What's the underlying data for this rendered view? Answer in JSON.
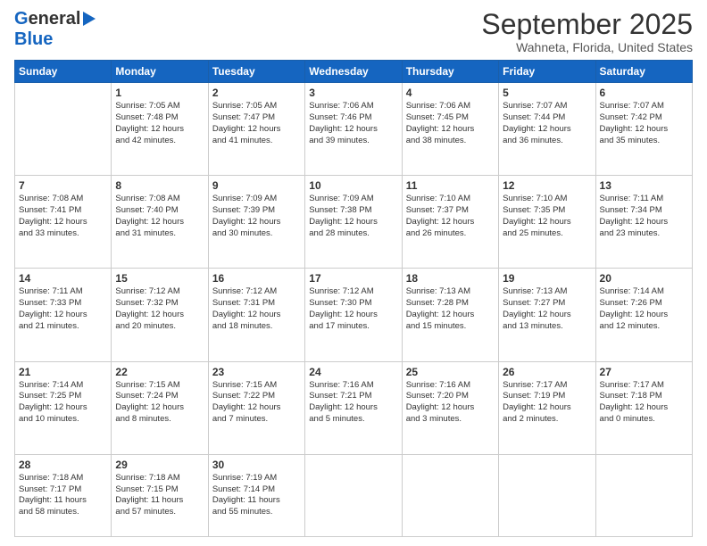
{
  "logo": {
    "line1": "General",
    "line2": "Blue",
    "arrow": true
  },
  "title": "September 2025",
  "subtitle": "Wahneta, Florida, United States",
  "weekdays": [
    "Sunday",
    "Monday",
    "Tuesday",
    "Wednesday",
    "Thursday",
    "Friday",
    "Saturday"
  ],
  "weeks": [
    [
      {
        "day": "",
        "info": ""
      },
      {
        "day": "1",
        "info": "Sunrise: 7:05 AM\nSunset: 7:48 PM\nDaylight: 12 hours\nand 42 minutes."
      },
      {
        "day": "2",
        "info": "Sunrise: 7:05 AM\nSunset: 7:47 PM\nDaylight: 12 hours\nand 41 minutes."
      },
      {
        "day": "3",
        "info": "Sunrise: 7:06 AM\nSunset: 7:46 PM\nDaylight: 12 hours\nand 39 minutes."
      },
      {
        "day": "4",
        "info": "Sunrise: 7:06 AM\nSunset: 7:45 PM\nDaylight: 12 hours\nand 38 minutes."
      },
      {
        "day": "5",
        "info": "Sunrise: 7:07 AM\nSunset: 7:44 PM\nDaylight: 12 hours\nand 36 minutes."
      },
      {
        "day": "6",
        "info": "Sunrise: 7:07 AM\nSunset: 7:42 PM\nDaylight: 12 hours\nand 35 minutes."
      }
    ],
    [
      {
        "day": "7",
        "info": "Sunrise: 7:08 AM\nSunset: 7:41 PM\nDaylight: 12 hours\nand 33 minutes."
      },
      {
        "day": "8",
        "info": "Sunrise: 7:08 AM\nSunset: 7:40 PM\nDaylight: 12 hours\nand 31 minutes."
      },
      {
        "day": "9",
        "info": "Sunrise: 7:09 AM\nSunset: 7:39 PM\nDaylight: 12 hours\nand 30 minutes."
      },
      {
        "day": "10",
        "info": "Sunrise: 7:09 AM\nSunset: 7:38 PM\nDaylight: 12 hours\nand 28 minutes."
      },
      {
        "day": "11",
        "info": "Sunrise: 7:10 AM\nSunset: 7:37 PM\nDaylight: 12 hours\nand 26 minutes."
      },
      {
        "day": "12",
        "info": "Sunrise: 7:10 AM\nSunset: 7:35 PM\nDaylight: 12 hours\nand 25 minutes."
      },
      {
        "day": "13",
        "info": "Sunrise: 7:11 AM\nSunset: 7:34 PM\nDaylight: 12 hours\nand 23 minutes."
      }
    ],
    [
      {
        "day": "14",
        "info": "Sunrise: 7:11 AM\nSunset: 7:33 PM\nDaylight: 12 hours\nand 21 minutes."
      },
      {
        "day": "15",
        "info": "Sunrise: 7:12 AM\nSunset: 7:32 PM\nDaylight: 12 hours\nand 20 minutes."
      },
      {
        "day": "16",
        "info": "Sunrise: 7:12 AM\nSunset: 7:31 PM\nDaylight: 12 hours\nand 18 minutes."
      },
      {
        "day": "17",
        "info": "Sunrise: 7:12 AM\nSunset: 7:30 PM\nDaylight: 12 hours\nand 17 minutes."
      },
      {
        "day": "18",
        "info": "Sunrise: 7:13 AM\nSunset: 7:28 PM\nDaylight: 12 hours\nand 15 minutes."
      },
      {
        "day": "19",
        "info": "Sunrise: 7:13 AM\nSunset: 7:27 PM\nDaylight: 12 hours\nand 13 minutes."
      },
      {
        "day": "20",
        "info": "Sunrise: 7:14 AM\nSunset: 7:26 PM\nDaylight: 12 hours\nand 12 minutes."
      }
    ],
    [
      {
        "day": "21",
        "info": "Sunrise: 7:14 AM\nSunset: 7:25 PM\nDaylight: 12 hours\nand 10 minutes."
      },
      {
        "day": "22",
        "info": "Sunrise: 7:15 AM\nSunset: 7:24 PM\nDaylight: 12 hours\nand 8 minutes."
      },
      {
        "day": "23",
        "info": "Sunrise: 7:15 AM\nSunset: 7:22 PM\nDaylight: 12 hours\nand 7 minutes."
      },
      {
        "day": "24",
        "info": "Sunrise: 7:16 AM\nSunset: 7:21 PM\nDaylight: 12 hours\nand 5 minutes."
      },
      {
        "day": "25",
        "info": "Sunrise: 7:16 AM\nSunset: 7:20 PM\nDaylight: 12 hours\nand 3 minutes."
      },
      {
        "day": "26",
        "info": "Sunrise: 7:17 AM\nSunset: 7:19 PM\nDaylight: 12 hours\nand 2 minutes."
      },
      {
        "day": "27",
        "info": "Sunrise: 7:17 AM\nSunset: 7:18 PM\nDaylight: 12 hours\nand 0 minutes."
      }
    ],
    [
      {
        "day": "28",
        "info": "Sunrise: 7:18 AM\nSunset: 7:17 PM\nDaylight: 11 hours\nand 58 minutes."
      },
      {
        "day": "29",
        "info": "Sunrise: 7:18 AM\nSunset: 7:15 PM\nDaylight: 11 hours\nand 57 minutes."
      },
      {
        "day": "30",
        "info": "Sunrise: 7:19 AM\nSunset: 7:14 PM\nDaylight: 11 hours\nand 55 minutes."
      },
      {
        "day": "",
        "info": ""
      },
      {
        "day": "",
        "info": ""
      },
      {
        "day": "",
        "info": ""
      },
      {
        "day": "",
        "info": ""
      }
    ]
  ]
}
